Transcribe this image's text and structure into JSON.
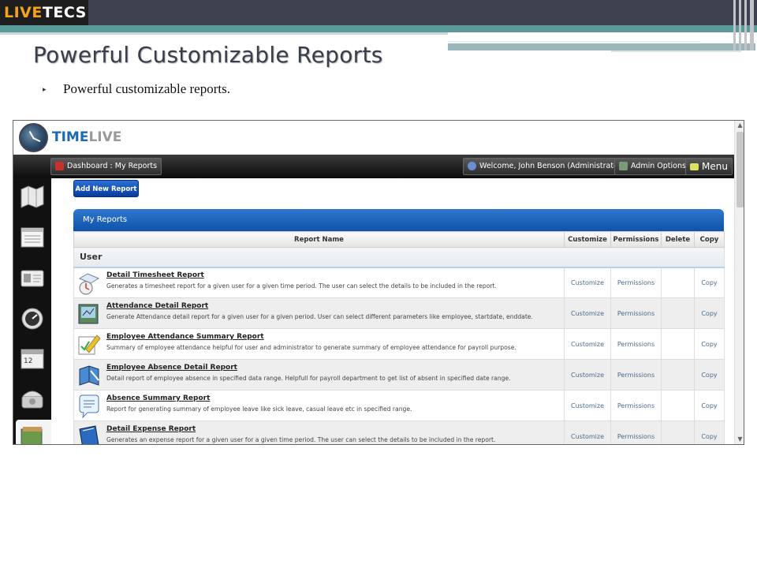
{
  "slide": {
    "logo_live": "LIVE",
    "logo_tecs": "TECS",
    "title": "Powerful Customizable Reports",
    "bullet": "Powerful customizable reports.",
    "bullet_glyph": "▸"
  },
  "app": {
    "brand_time": "TIME",
    "brand_live": "LIVE",
    "nav": {
      "dashboard": "Dashboard : My Reports",
      "welcome": "Welcome, John Benson (Administrator)",
      "admin": "Admin Options",
      "menu": "Menu"
    },
    "add_button": "Add New Report",
    "panel_title": "My Reports",
    "columns": [
      "Report Name",
      "Customize",
      "Permissions",
      "Delete",
      "Copy"
    ],
    "group": "User",
    "reports": [
      {
        "title": "Detail Timesheet Report",
        "desc": "Generates a timesheet report for a given user for a given time period. The user can select the details to be included in the report.",
        "customize": "Customize",
        "permissions": "Permissions",
        "delete": "",
        "copy": "Copy",
        "icon": "timesheet-icon"
      },
      {
        "title": "Attendance Detail Report",
        "desc": "Generate Attendance detail report for a given user for a given period. User can select different parameters like employee, startdate, enddate.",
        "customize": "Customize",
        "permissions": "Permissions",
        "delete": "",
        "copy": "Copy",
        "icon": "attendance-icon"
      },
      {
        "title": "Employee Attendance Summary Report",
        "desc": "Summary of employee attendance helpful for user and administrator to generate summary of employee attendance for payroll purpose.",
        "customize": "Customize",
        "permissions": "Permissions",
        "delete": "",
        "copy": "Copy",
        "icon": "pencil-icon"
      },
      {
        "title": "Employee Absence Detail Report",
        "desc": "Detail report of employee absence in specified data range. Helpfull for payroll department to get list of absent in specified date range.",
        "customize": "Customize",
        "permissions": "Permissions",
        "delete": "",
        "copy": "Copy",
        "icon": "book-icon"
      },
      {
        "title": "Absence Summary Report",
        "desc": "Report for generating summary of employee leave like sick leave, casual leave etc in specified range.",
        "customize": "Customize",
        "permissions": "Permissions",
        "delete": "",
        "copy": "Copy",
        "icon": "speech-bubble-icon"
      },
      {
        "title": "Detail Expense Report",
        "desc": "Generates an expense report for a given user for a given time period. The user can select the details to be included in the report.",
        "customize": "Customize",
        "permissions": "Permissions",
        "delete": "",
        "copy": "Copy",
        "icon": "expense-book-icon"
      }
    ],
    "sidebar_icons": [
      "map-icon",
      "document-icon",
      "id-card-icon",
      "gauge-icon",
      "calendar-icon",
      "telephone-icon",
      "photos-icon"
    ],
    "calendar_day": "12",
    "colors": {
      "accent": "#1d6ab0",
      "panel": "#0e52a8",
      "logo_orange": "#f7a21b"
    }
  }
}
